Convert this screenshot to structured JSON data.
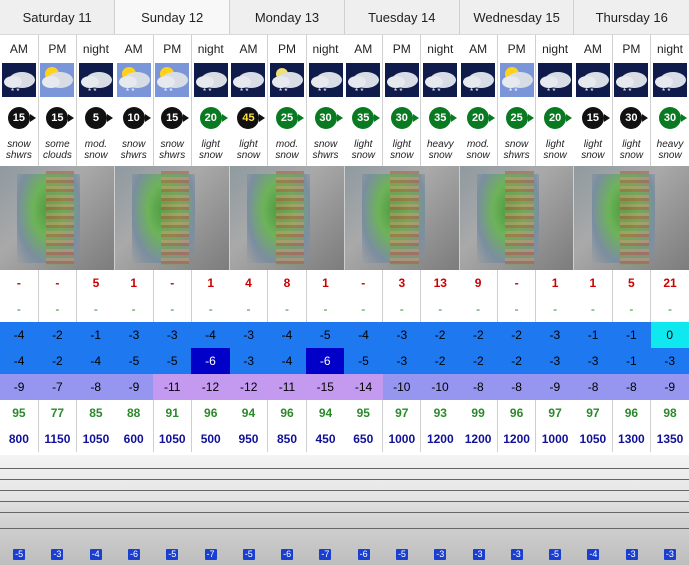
{
  "days": [
    {
      "label": "Saturday 11",
      "light": false
    },
    {
      "label": "Sunday 12",
      "light": true
    },
    {
      "label": "Monday 13",
      "light": false
    },
    {
      "label": "Tuesday 14",
      "light": false
    },
    {
      "label": "Wednesday 15",
      "light": false
    },
    {
      "label": "Thursday 16",
      "light": false
    }
  ],
  "periods": [
    "AM",
    "PM",
    "night",
    "AM",
    "PM",
    "night",
    "AM",
    "PM",
    "night",
    "AM",
    "PM",
    "night",
    "AM",
    "PM",
    "night",
    "AM",
    "PM",
    "night"
  ],
  "icons": [
    "snow-cloud-icon",
    "sun-cloud-icon",
    "snow-cloud-icon",
    "sun-snow-cloud-icon",
    "sun-snow-cloud-icon",
    "snow-cloud-icon",
    "snow-cloud-icon",
    "moon-snow-cloud-icon",
    "snow-cloud-icon",
    "snow-cloud-icon",
    "snow-cloud-icon",
    "snow-cloud-icon",
    "snow-cloud-icon",
    "sun-snow-cloud-icon",
    "snow-cloud-icon",
    "snow-cloud-icon",
    "snow-cloud-icon",
    "snow-cloud-icon"
  ],
  "wind": [
    {
      "v": "15",
      "c": "k"
    },
    {
      "v": "15",
      "c": "k"
    },
    {
      "v": "5",
      "c": "k"
    },
    {
      "v": "10",
      "c": "k"
    },
    {
      "v": "15",
      "c": "k"
    },
    {
      "v": "20",
      "c": "g"
    },
    {
      "v": "45",
      "c": "k"
    },
    {
      "v": "25",
      "c": "g"
    },
    {
      "v": "30",
      "c": "g"
    },
    {
      "v": "35",
      "c": "g"
    },
    {
      "v": "30",
      "c": "g"
    },
    {
      "v": "35",
      "c": "g"
    },
    {
      "v": "20",
      "c": "g"
    },
    {
      "v": "25",
      "c": "g"
    },
    {
      "v": "20",
      "c": "g"
    },
    {
      "v": "15",
      "c": "k"
    },
    {
      "v": "30",
      "c": "k"
    },
    {
      "v": "30",
      "c": "g"
    }
  ],
  "summary": [
    [
      "snow",
      "shwrs"
    ],
    [
      "some",
      "clouds"
    ],
    [
      "mod.",
      "snow"
    ],
    [
      "snow",
      "shwrs"
    ],
    [
      "snow",
      "shwrs"
    ],
    [
      "light",
      "snow"
    ],
    [
      "light",
      "snow"
    ],
    [
      "mod.",
      "snow"
    ],
    [
      "snow",
      "shwrs"
    ],
    [
      "light",
      "snow"
    ],
    [
      "light",
      "snow"
    ],
    [
      "heavy",
      "snow"
    ],
    [
      "mod.",
      "snow"
    ],
    [
      "snow",
      "shwrs"
    ],
    [
      "light",
      "snow"
    ],
    [
      "light",
      "snow"
    ],
    [
      "light",
      "snow"
    ],
    [
      "heavy",
      "snow"
    ]
  ],
  "snow": [
    "-",
    "-",
    "5",
    "1",
    "-",
    "1",
    "4",
    "8",
    "1",
    "-",
    "3",
    "13",
    "9",
    "-",
    "1",
    "1",
    "5",
    "21"
  ],
  "rain": [
    "-",
    "-",
    "-",
    "-",
    "-",
    "-",
    "-",
    "-",
    "-",
    "-",
    "-",
    "-",
    "-",
    "-",
    "-",
    "-",
    "-",
    "-"
  ],
  "freeze_max": [
    {
      "v": "-4",
      "bg": "#1e78f0",
      "fg": "#000"
    },
    {
      "v": "-2",
      "bg": "#1e78f0",
      "fg": "#000"
    },
    {
      "v": "-1",
      "bg": "#1e78f0",
      "fg": "#000"
    },
    {
      "v": "-3",
      "bg": "#1e78f0",
      "fg": "#000"
    },
    {
      "v": "-3",
      "bg": "#1e78f0",
      "fg": "#000"
    },
    {
      "v": "-4",
      "bg": "#1e78f0",
      "fg": "#000"
    },
    {
      "v": "-3",
      "bg": "#1e78f0",
      "fg": "#000"
    },
    {
      "v": "-4",
      "bg": "#1e78f0",
      "fg": "#000"
    },
    {
      "v": "-5",
      "bg": "#1e78f0",
      "fg": "#000"
    },
    {
      "v": "-4",
      "bg": "#1e78f0",
      "fg": "#000"
    },
    {
      "v": "-3",
      "bg": "#1e78f0",
      "fg": "#000"
    },
    {
      "v": "-2",
      "bg": "#1e78f0",
      "fg": "#000"
    },
    {
      "v": "-2",
      "bg": "#1e78f0",
      "fg": "#000"
    },
    {
      "v": "-2",
      "bg": "#1e78f0",
      "fg": "#000"
    },
    {
      "v": "-3",
      "bg": "#1e78f0",
      "fg": "#000"
    },
    {
      "v": "-1",
      "bg": "#1e78f0",
      "fg": "#000"
    },
    {
      "v": "-1",
      "bg": "#1e78f0",
      "fg": "#000"
    },
    {
      "v": "0",
      "bg": "#10e8f0",
      "fg": "#000"
    }
  ],
  "freeze_min": [
    {
      "v": "-4",
      "bg": "#1e78f0",
      "fg": "#000"
    },
    {
      "v": "-2",
      "bg": "#1e78f0",
      "fg": "#000"
    },
    {
      "v": "-4",
      "bg": "#1e78f0",
      "fg": "#000"
    },
    {
      "v": "-5",
      "bg": "#1e78f0",
      "fg": "#000"
    },
    {
      "v": "-5",
      "bg": "#1e78f0",
      "fg": "#000"
    },
    {
      "v": "-6",
      "bg": "#0000c8",
      "fg": "#fff"
    },
    {
      "v": "-3",
      "bg": "#1e78f0",
      "fg": "#000"
    },
    {
      "v": "-4",
      "bg": "#1e78f0",
      "fg": "#000"
    },
    {
      "v": "-6",
      "bg": "#0000c8",
      "fg": "#fff"
    },
    {
      "v": "-5",
      "bg": "#1e78f0",
      "fg": "#000"
    },
    {
      "v": "-3",
      "bg": "#1e78f0",
      "fg": "#000"
    },
    {
      "v": "-2",
      "bg": "#1e78f0",
      "fg": "#000"
    },
    {
      "v": "-2",
      "bg": "#1e78f0",
      "fg": "#000"
    },
    {
      "v": "-2",
      "bg": "#1e78f0",
      "fg": "#000"
    },
    {
      "v": "-3",
      "bg": "#1e78f0",
      "fg": "#000"
    },
    {
      "v": "-3",
      "bg": "#1e78f0",
      "fg": "#000"
    },
    {
      "v": "-1",
      "bg": "#1e78f0",
      "fg": "#000"
    },
    {
      "v": "-3",
      "bg": "#1e78f0",
      "fg": "#000"
    }
  ],
  "chill": [
    {
      "v": "-9",
      "bg": "#9696f0"
    },
    {
      "v": "-7",
      "bg": "#9696f0"
    },
    {
      "v": "-8",
      "bg": "#9696f0"
    },
    {
      "v": "-9",
      "bg": "#9696f0"
    },
    {
      "v": "-11",
      "bg": "#c49af0"
    },
    {
      "v": "-12",
      "bg": "#c49af0"
    },
    {
      "v": "-12",
      "bg": "#c49af0"
    },
    {
      "v": "-11",
      "bg": "#c49af0"
    },
    {
      "v": "-15",
      "bg": "#c49af0"
    },
    {
      "v": "-14",
      "bg": "#c49af0"
    },
    {
      "v": "-10",
      "bg": "#9696f0"
    },
    {
      "v": "-10",
      "bg": "#9696f0"
    },
    {
      "v": "-8",
      "bg": "#9696f0"
    },
    {
      "v": "-8",
      "bg": "#9696f0"
    },
    {
      "v": "-9",
      "bg": "#9696f0"
    },
    {
      "v": "-8",
      "bg": "#9696f0"
    },
    {
      "v": "-8",
      "bg": "#9696f0"
    },
    {
      "v": "-9",
      "bg": "#9696f0"
    }
  ],
  "humidity": [
    "95",
    "77",
    "85",
    "88",
    "91",
    "96",
    "94",
    "96",
    "94",
    "95",
    "97",
    "93",
    "99",
    "96",
    "97",
    "97",
    "96",
    "98"
  ],
  "cloudbase": [
    "800",
    "1150",
    "1050",
    "600",
    "1050",
    "500",
    "950",
    "850",
    "450",
    "650",
    "1000",
    "1200",
    "1200",
    "1200",
    "1000",
    "1050",
    "1300",
    "1350"
  ],
  "bottom_ticks": [
    "-5",
    "-3",
    "-4",
    "-6",
    "-5",
    "-7",
    "-5",
    "-6",
    "-7",
    "-6",
    "-5",
    "-3",
    "-3",
    "-3",
    "-5",
    "-4",
    "-3",
    "-3"
  ]
}
